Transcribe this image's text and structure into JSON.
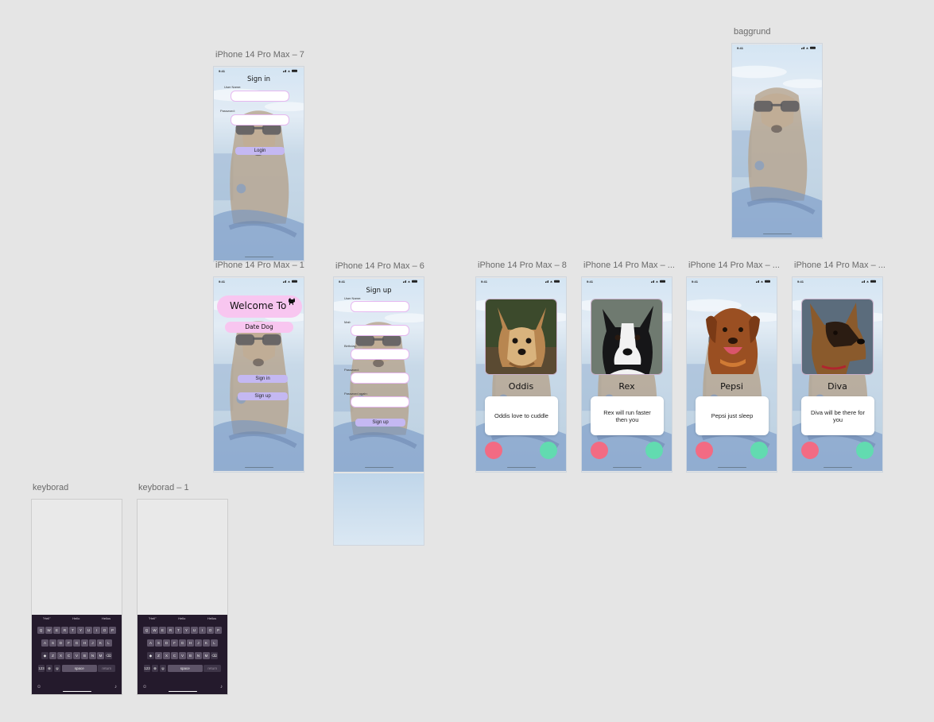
{
  "colors": {
    "canvas": "#e5e5e5",
    "sky": "#c6dcef",
    "field_border": "#e6b8f0",
    "button_purple": "#c4b8f2",
    "pill_pink": "#f8c6f0",
    "dislike": "#f26b83",
    "like": "#62dbb0",
    "keyboard": "#241a2c"
  },
  "status_time": "9:41",
  "artboards": {
    "signin": {
      "label": "iPhone 14 Pro Max – 7",
      "title": "Sign in",
      "username_label": "User Name:",
      "password_label": "Password:",
      "login_button": "Login"
    },
    "welcome": {
      "label": "iPhone 14 Pro Max – 1",
      "welcome_text": "Welcome To",
      "app_name": "Date Dog",
      "signin_button": "Sign in",
      "signup_button": "Sign up",
      "logo_icon": "dog-icon"
    },
    "signup": {
      "label": "iPhone 14 Pro Max – 6",
      "title": "Sign up",
      "fields": [
        "User Name:",
        "Mail:",
        "Birthday:",
        "Password:",
        "Password again:"
      ],
      "signup_button": "Sign up"
    },
    "background": {
      "label": "baggrund"
    },
    "profiles": [
      {
        "label": "iPhone 14 Pro Max – 8",
        "name": "Oddis",
        "bio": "Oddis love to cuddle",
        "breed_icon": "yorkshire-terrier"
      },
      {
        "label": "iPhone 14 Pro Max – ...",
        "name": "Rex",
        "bio": "Rex will run faster then you",
        "breed_icon": "border-collie"
      },
      {
        "label": "iPhone 14 Pro Max – ...",
        "name": "Pepsi",
        "bio": "Pepsi just sleep",
        "breed_icon": "labrador"
      },
      {
        "label": "iPhone 14 Pro Max – ...",
        "name": "Diva",
        "bio": "Diva will be there for you",
        "breed_icon": "german-shepherd"
      }
    ],
    "keyboards": [
      {
        "label": "keyborad"
      },
      {
        "label": "keyborad – 1"
      }
    ]
  },
  "keyboard": {
    "suggestions": [
      "\"Hell\"",
      "Hello",
      "Hellos"
    ],
    "row1": [
      "Q",
      "W",
      "E",
      "R",
      "T",
      "Y",
      "U",
      "I",
      "O",
      "P"
    ],
    "row2": [
      "A",
      "S",
      "D",
      "F",
      "G",
      "H",
      "J",
      "K",
      "L"
    ],
    "row3": [
      "Z",
      "X",
      "C",
      "V",
      "B",
      "N",
      "M"
    ],
    "shift": "◆",
    "delete": "⌫",
    "numbers": "123",
    "emoji": "☺",
    "mic": "♪",
    "space": "space",
    "return": "return"
  }
}
